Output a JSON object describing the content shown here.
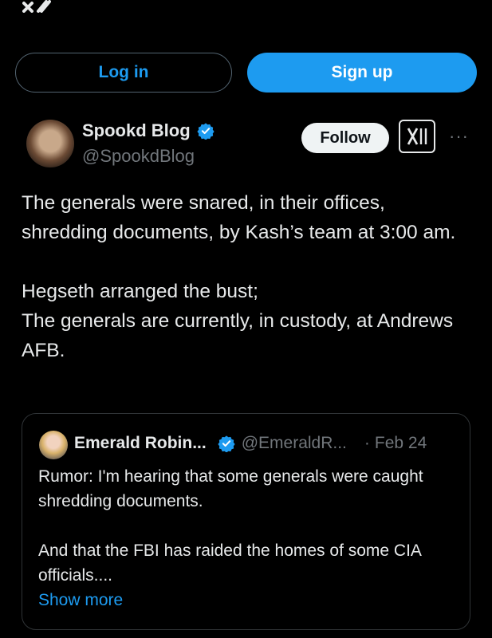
{
  "header": {
    "logo_icon": "x-logo-icon",
    "login_label": "Log in",
    "signup_label": "Sign up"
  },
  "post": {
    "author_name": "Spookd Blog",
    "author_handle": "@SpookdBlog",
    "verified": true,
    "follow_label": "Follow",
    "more_label": "···",
    "lines": [
      "The generals were snared, in their offices, shredding documents, by Kash’s team at 3:00 am.",
      "",
      "Hegseth arranged the bust;",
      "The generals are currently, in custody, at Andrews AFB."
    ]
  },
  "quote": {
    "author_name": "Emerald Robin...",
    "author_handle": "@EmeraldR...",
    "separator": "·",
    "date": "Feb 24",
    "lines": [
      "Rumor: I'm hearing that some generals were caught shredding documents.",
      "",
      "And that the FBI has raided the homes of some CIA officials...."
    ],
    "show_more_label": "Show more"
  },
  "colors": {
    "accent": "#1d9bf0",
    "background": "#000000",
    "text": "#e7e9ea",
    "muted": "#71767b"
  }
}
